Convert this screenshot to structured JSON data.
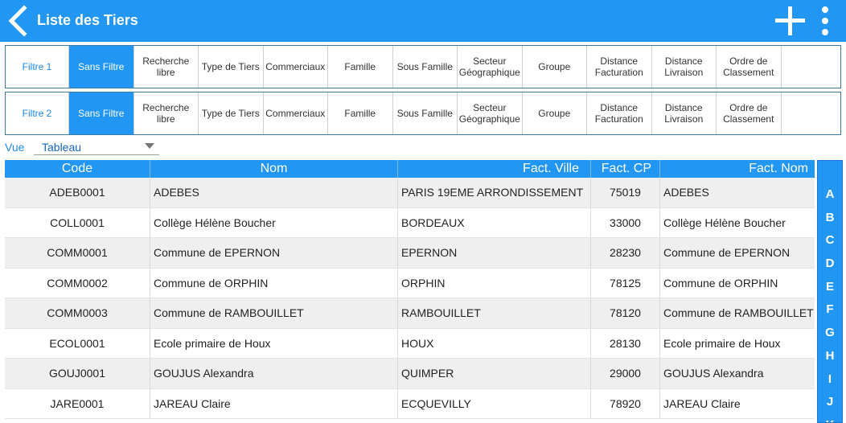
{
  "appbar": {
    "title": "Liste des Tiers",
    "back_icon": "chevron-left-icon",
    "add_icon": "plus-icon",
    "more_icon": "vertical-dots-icon",
    "color": "#2196f3"
  },
  "filters": [
    {
      "label": "Filtre 1",
      "options": [
        "Sans Filtre",
        "Recherche libre",
        "Type de Tiers",
        "Commerciaux",
        "Famille",
        "Sous Famille",
        "Secteur Géographique",
        "Groupe",
        "Distance Facturation",
        "Distance Livraison",
        "Ordre de Classement"
      ],
      "active": "Sans Filtre"
    },
    {
      "label": "Filtre 2",
      "options": [
        "Sans Filtre",
        "Recherche libre",
        "Type de Tiers",
        "Commerciaux",
        "Famille",
        "Sous Famille",
        "Secteur Géographique",
        "Groupe",
        "Distance Facturation",
        "Distance Livraison",
        "Ordre de Classement"
      ],
      "active": "Sans Filtre"
    }
  ],
  "vue": {
    "label": "Vue",
    "value": "Tableau"
  },
  "table": {
    "columns": [
      "Code",
      "Nom",
      "Fact. Ville",
      "Fact. CP",
      "Fact. Nom"
    ],
    "rows": [
      [
        "ADEB0001",
        "ADEBES",
        "PARIS 19EME ARRONDISSEMENT",
        "75019",
        "ADEBES"
      ],
      [
        "COLL0001",
        "Collège Hélène Boucher",
        "BORDEAUX",
        "33000",
        "Collège Hélène Boucher"
      ],
      [
        "COMM0001",
        "Commune de EPERNON",
        "EPERNON",
        "28230",
        "Commune de EPERNON"
      ],
      [
        "COMM0002",
        "Commune de ORPHIN",
        "ORPHIN",
        "78125",
        "Commune de ORPHIN"
      ],
      [
        "COMM0003",
        "Commune de RAMBOUILLET",
        "RAMBOUILLET",
        "78120",
        "Commune de RAMBOUILLET"
      ],
      [
        "ECOL0001",
        "Ecole primaire de Houx",
        "HOUX",
        "28130",
        "Ecole primaire de Houx"
      ],
      [
        "GOUJ0001",
        "GOUJUS Alexandra",
        "QUIMPER",
        "29000",
        "GOUJUS Alexandra"
      ],
      [
        "JARE0001",
        "JAREAU Claire",
        "ECQUEVILLY",
        "78920",
        "JAREAU Claire"
      ]
    ]
  },
  "alphabet": [
    "A",
    "B",
    "C",
    "D",
    "E",
    "F",
    "G",
    "H",
    "I",
    "J",
    "K"
  ]
}
